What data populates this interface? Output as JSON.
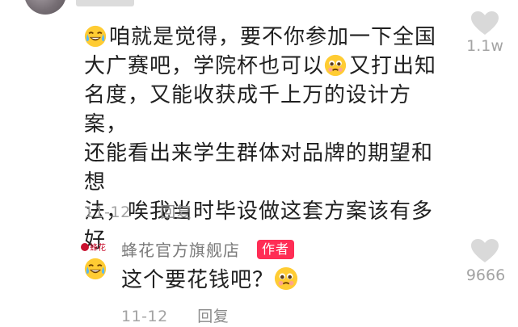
{
  "comment": {
    "line1": "咱就是觉得，要不你参加一下全国",
    "line2a": "大广赛吧，学院杯也可以",
    "line2b": "又打出知",
    "line3": "名度，又能收获成千上万的设计方案，",
    "line4": "还能看出来学生群体对品牌的期望和想",
    "line5": "法，唉我当时毕设做这套方案该有多好",
    "date": "11-12",
    "reply_label": "回复",
    "likes": "1.1w"
  },
  "reply": {
    "shop_logo_text": "蜂花",
    "shop_name": "蜂花官方旗舰店",
    "badge": "作者",
    "text": "这个要花钱吧？",
    "date": "11-12",
    "reply_label": "回复",
    "likes": "9666"
  },
  "icons": {
    "laugh_cry": "laughing-crying-emoji-icon",
    "pleading": "pleading-face-emoji-icon",
    "heart": "heart-icon"
  },
  "colors": {
    "badge": "#ff2d55",
    "meta_gray": "#a3a3a3",
    "heart_gray": "#d9d9d9"
  }
}
